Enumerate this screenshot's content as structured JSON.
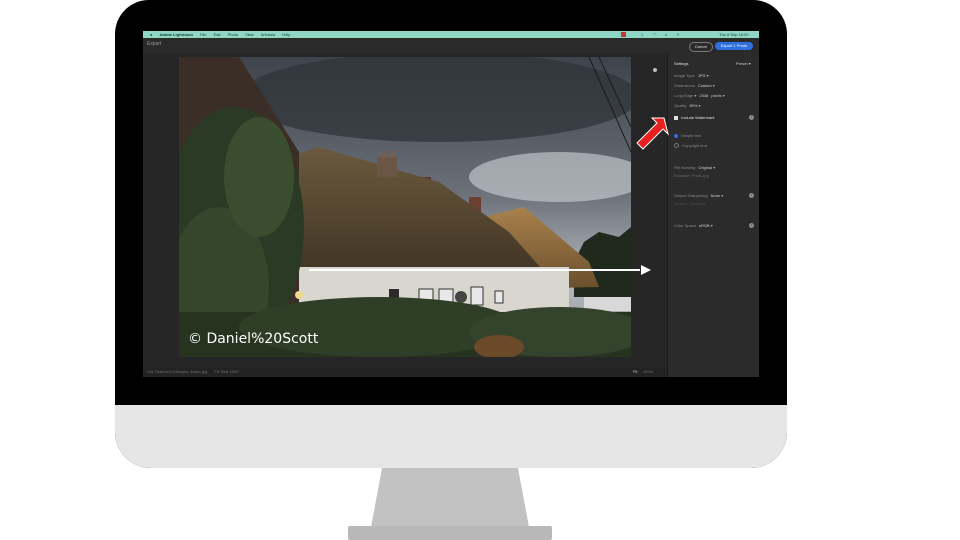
{
  "menubar": {
    "apple": "",
    "app_name": "Adobe Lightroom",
    "items": [
      "File",
      "Edit",
      "Photo",
      "View",
      "Window",
      "Help"
    ],
    "clock": "Thu 8 Sep 15:00"
  },
  "toolbar": {
    "breadcrumb": "Export",
    "cancel_label": "Cancel",
    "export_label": "Export 1 Photo"
  },
  "status": {
    "filename": "Old Thatched Cottages, Adare.jpg",
    "size": "Fit Time 1000",
    "zoom_fit": "Fit",
    "zoom_pct": "100%"
  },
  "settings": {
    "title": "Settings",
    "preset": "Preset",
    "image_type_label": "Image Type",
    "image_type_value": "JPG",
    "dimensions_label": "Dimensions",
    "dimensions_value": "Custom",
    "long_edge_label": "Long Edge",
    "long_edge_value": "2048",
    "long_edge_unit": "pixels",
    "quality_label": "Quality",
    "quality_value": "80%",
    "watermark_label": "Include Watermark",
    "watermark_options": [
      "Simple text",
      "Copyright text"
    ],
    "file_naming_label": "File Naming",
    "file_naming_value": "Original",
    "file_naming_hint": "Example: Photo.jpg",
    "output_sharpening_label": "Output Sharpening",
    "output_sharpening_value": "None",
    "sharpening_hint": "Screen, Standard",
    "color_space_label": "Color Space",
    "color_space_value": "sRGB"
  },
  "photo": {
    "watermark_text": "© Daniel%20Scott"
  },
  "colors": {
    "menubar": "#8fd6c4",
    "accent_blue": "#2f6fe0",
    "arrow_red": "#e82020",
    "bezel": "#000000",
    "chin": "#e6e6e6"
  }
}
